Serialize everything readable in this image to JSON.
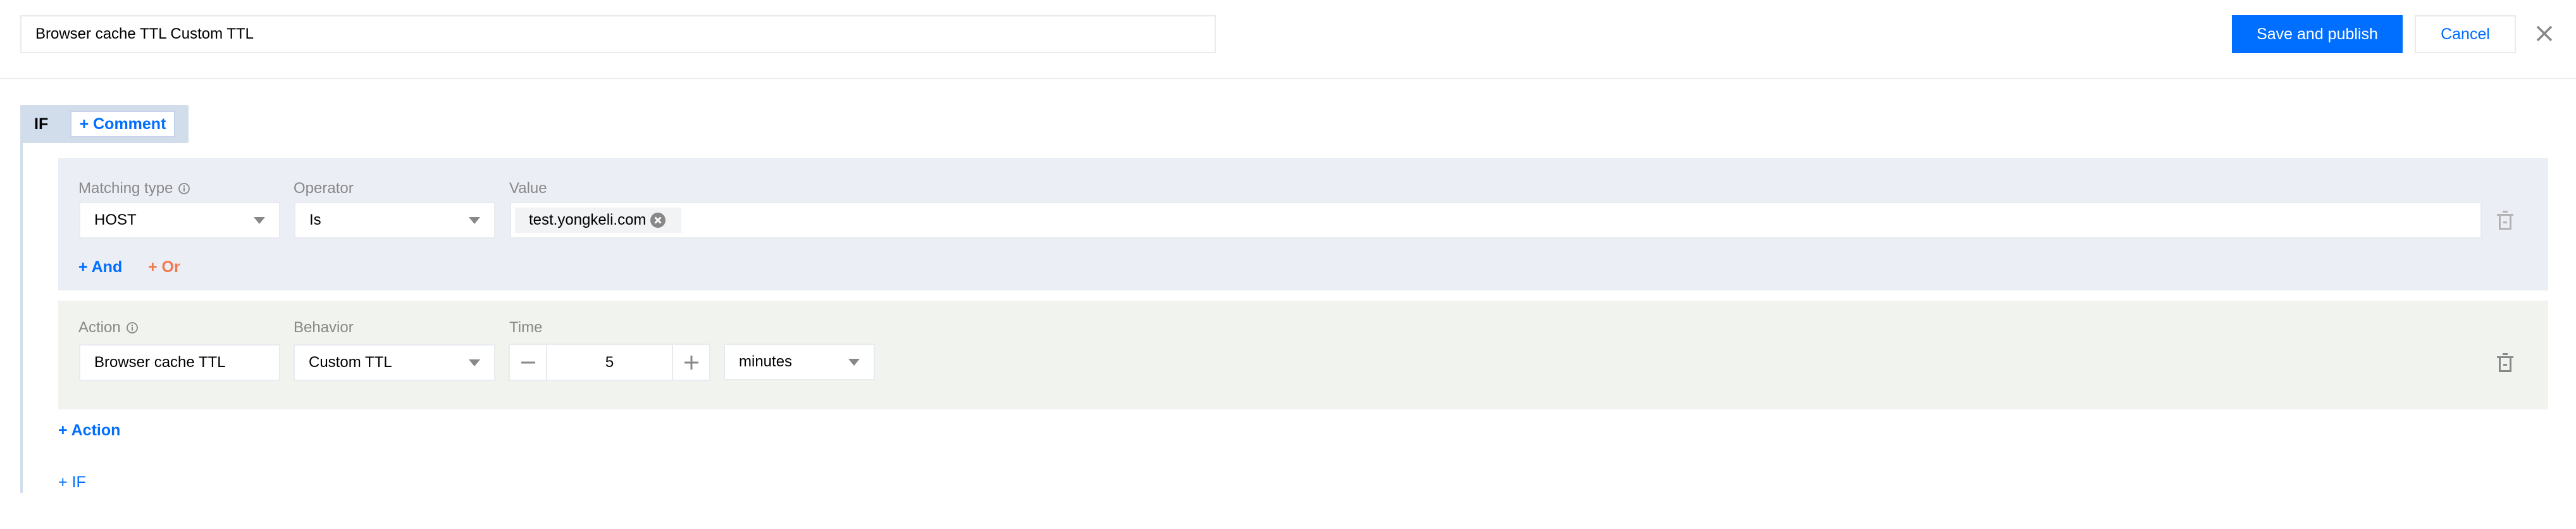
{
  "header": {
    "rule_name": "Browser cache TTL Custom TTL",
    "save_label": "Save and publish",
    "cancel_label": "Cancel",
    "close_icon": "close-icon"
  },
  "if_block": {
    "label": "IF",
    "comment_label": "+ Comment",
    "condition": {
      "matching_type_label": "Matching type",
      "operator_label": "Operator",
      "value_label": "Value",
      "matching_type_value": "HOST",
      "operator_value": "Is",
      "value_tags": [
        "test.yongkeli.com"
      ],
      "and_label": "+ And",
      "or_label": "+ Or"
    },
    "action": {
      "action_label": "Action",
      "behavior_label": "Behavior",
      "time_label": "Time",
      "action_value": "Browser cache TTL",
      "behavior_value": "Custom TTL",
      "time_value": "5",
      "time_unit": "minutes"
    },
    "add_action_label": "+ Action",
    "add_if_label": "+ IF"
  },
  "colors": {
    "primary": "#006eff",
    "or_link": "#f0794f",
    "condition_bg": "#ebeef5",
    "action_bg": "#f1f3ee",
    "if_header_bg": "#d2ddec"
  }
}
